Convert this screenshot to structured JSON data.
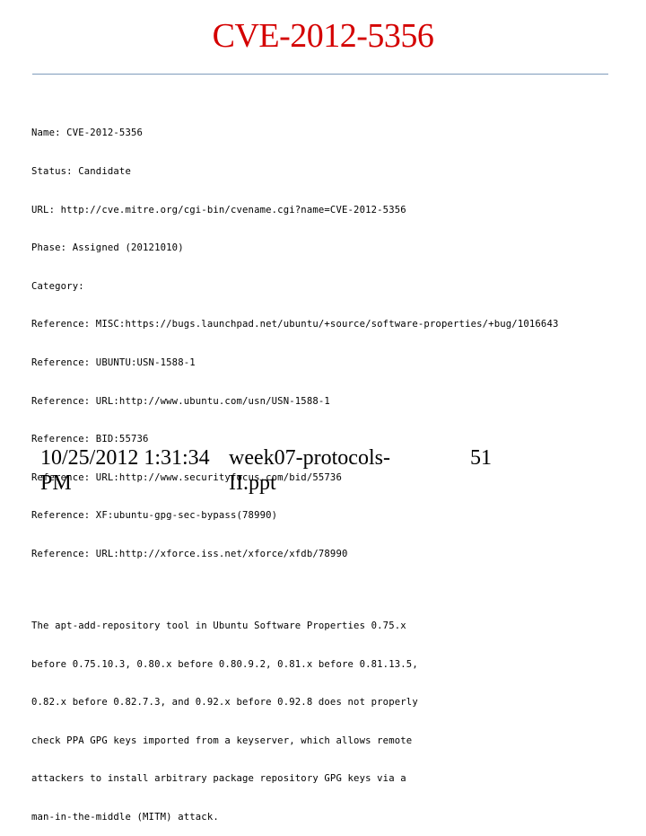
{
  "slide": {
    "title": "CVE-2012-5356",
    "title_color": "#d40000",
    "rule_color": "#7f9bbb"
  },
  "cve_record": {
    "fields": [
      "Name: CVE-2012-5356",
      "Status: Candidate",
      "URL: http://cve.mitre.org/cgi-bin/cvename.cgi?name=CVE-2012-5356",
      "Phase: Assigned (20121010)",
      "Category:",
      "Reference: MISC:https://bugs.launchpad.net/ubuntu/+source/software-properties/+bug/1016643",
      "Reference: UBUNTU:USN-1588-1",
      "Reference: URL:http://www.ubuntu.com/usn/USN-1588-1",
      "Reference: BID:55736",
      "Reference: URL:http://www.securityfocus.com/bid/55736",
      "Reference: XF:ubuntu-gpg-sec-bypass(78990)",
      "Reference: URL:http://xforce.iss.net/xforce/xfdb/78990"
    ],
    "description": [
      "The apt-add-repository tool in Ubuntu Software Properties 0.75.x",
      "before 0.75.10.3, 0.80.x before 0.80.9.2, 0.81.x before 0.81.13.5,",
      "0.82.x before 0.82.7.3, and 0.92.x before 0.92.8 does not properly",
      "check PPA GPG keys imported from a keyserver, which allows remote",
      "attackers to install arbitrary package repository GPG keys via a",
      "man-in-the-middle (MITM) attack."
    ]
  },
  "footer": {
    "date": "10/25/2012 1:31:34 PM",
    "filename": "week07-protocols-II.ppt",
    "page_number": "51"
  }
}
